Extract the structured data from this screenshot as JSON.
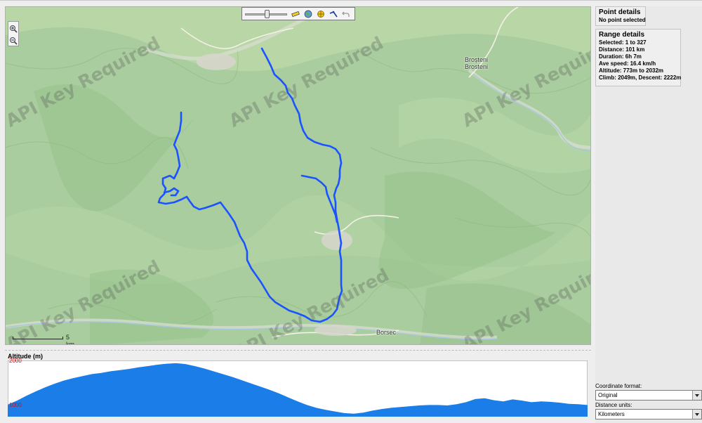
{
  "map": {
    "watermark_text": "API Key Required",
    "towns": [
      {
        "label": "Broșteni"
      },
      {
        "label": "Brosteni"
      },
      {
        "label": "Borsec"
      }
    ],
    "scale_label": "5 km",
    "track_color": "#1a53ff"
  },
  "toolbar": {
    "tools": [
      "zoom-slider",
      "ruler-icon",
      "globe-icon",
      "crosshair-icon",
      "route-icon",
      "undo-icon"
    ]
  },
  "profile": {
    "title": "Altitude (m)",
    "max_label": "2000",
    "min_label": "1000",
    "fill_color": "#1a7de8",
    "altitudes_m": [
      1000,
      1100,
      1220,
      1330,
      1430,
      1520,
      1600,
      1660,
      1710,
      1760,
      1790,
      1830,
      1860,
      1890,
      1930,
      1960,
      1995,
      2020,
      2032,
      2010,
      1960,
      1900,
      1830,
      1760,
      1690,
      1610,
      1530,
      1450,
      1370,
      1280,
      1180,
      1080,
      990,
      920,
      870,
      830,
      790,
      775,
      800,
      850,
      890,
      920,
      940,
      960,
      980,
      990,
      990,
      980,
      1010,
      1060,
      1140,
      1160,
      1110,
      1080,
      1130,
      1100,
      1060,
      1080,
      1070,
      1050,
      1020,
      1010,
      990
    ]
  },
  "point_details": {
    "title": "Point details",
    "text": "No point selected"
  },
  "range_details": {
    "title": "Range details",
    "lines": [
      "Selected: 1 to 327",
      "Distance: 101 km",
      "Duration: 6h 7m",
      "Ave speed: 16.4 km/h",
      "Altitude: 773m to 2032m",
      "Climb: 2049m, Descent: 2222m"
    ]
  },
  "settings": {
    "coord_label": "Coordinate format:",
    "coord_value": "Original",
    "dist_label": "Distance units:",
    "dist_value": "Kilometers"
  }
}
